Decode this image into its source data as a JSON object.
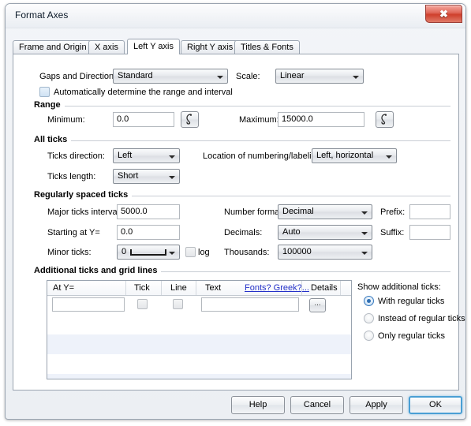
{
  "window": {
    "title": "Format Axes",
    "close_icon": "close-icon",
    "close_glyph": "✖"
  },
  "tabs": [
    {
      "label": "Frame and Origin",
      "active": false
    },
    {
      "label": "X axis",
      "active": false
    },
    {
      "label": "Left Y axis",
      "active": true
    },
    {
      "label": "Right Y axis",
      "active": false
    },
    {
      "label": "Titles & Fonts",
      "active": false
    }
  ],
  "top": {
    "gaps_label": "Gaps and Direction:",
    "gaps_value": "Standard",
    "scale_label": "Scale:",
    "scale_value": "Linear",
    "auto_checkbox_label": "Automatically determine the range and interval",
    "auto_checked": false
  },
  "range": {
    "group_title": "Range",
    "minimum_label": "Minimum:",
    "minimum_value": "0.0",
    "maximum_label": "Maximum:",
    "maximum_value": "15000.0",
    "picker_icon": "magnet-picker-icon"
  },
  "all_ticks": {
    "group_title": "All ticks",
    "direction_label": "Ticks direction:",
    "direction_value": "Left",
    "length_label": "Ticks length:",
    "length_value": "Short",
    "location_label": "Location of numbering/labeling:",
    "location_value": "Left, horizontal"
  },
  "regular_ticks": {
    "group_title": "Regularly spaced ticks",
    "major_interval_label": "Major ticks interval:",
    "major_interval_value": "5000.0",
    "starting_label": "Starting at Y=",
    "starting_value": "0.0",
    "minor_label": "Minor ticks:",
    "minor_value": "0",
    "log_label": "log",
    "log_checked": false,
    "number_format_label": "Number format:",
    "number_format_value": "Decimal",
    "decimals_label": "Decimals:",
    "decimals_value": "Auto",
    "thousands_label": "Thousands:",
    "thousands_value": "100000",
    "prefix_label": "Prefix:",
    "prefix_value": "",
    "suffix_label": "Suffix:",
    "suffix_value": ""
  },
  "additional": {
    "group_title": "Additional ticks and grid lines",
    "columns": [
      "At Y=",
      "Tick",
      "Line",
      "Text",
      "Fonts? Greek?...",
      "Details"
    ],
    "row": {
      "at_y": "",
      "tick_checked": false,
      "line_checked": false,
      "text": "",
      "details_label": "..."
    },
    "show_label": "Show additional ticks:",
    "options": [
      {
        "label": "With regular ticks",
        "selected": true
      },
      {
        "label": "Instead of regular ticks",
        "selected": false
      },
      {
        "label": "Only regular ticks",
        "selected": false
      }
    ]
  },
  "footer": {
    "help": "Help",
    "cancel": "Cancel",
    "apply": "Apply",
    "ok": "OK"
  },
  "colors": {
    "link": "#2330c8",
    "default_button_border": "#4a9fd4",
    "close_button": "#cf3f2c",
    "row_alt": "#eef2fa"
  }
}
